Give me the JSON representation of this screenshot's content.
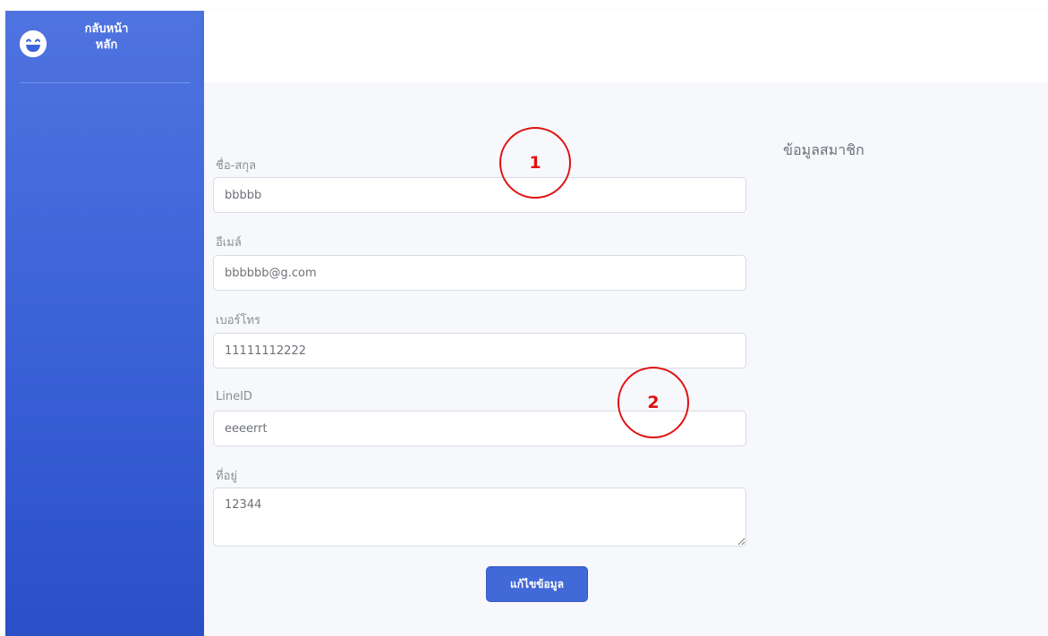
{
  "sidebar": {
    "brand_line1": "กลับหน้า",
    "brand_line2": "หลัก",
    "brand_icon": "laughing-face-icon"
  },
  "page": {
    "title": "ข้อมูลสมาชิก"
  },
  "form": {
    "name": {
      "label": "ชื่อ-สกุล",
      "value": "bbbbb"
    },
    "email": {
      "label": "อีเมล์",
      "value": "bbbbbb@g.com"
    },
    "phone": {
      "label": "เบอร์โทร",
      "value": "11111112222"
    },
    "lineid": {
      "label": "LineID",
      "value": "eeeerrt"
    },
    "address": {
      "label": "ที่อยู่",
      "value": "12344"
    },
    "submit_label": "แก้ไขข้อมูล"
  },
  "annotations": {
    "marker1": "1",
    "marker2": "2",
    "color": "#e01010"
  },
  "colors": {
    "sidebar_top": "#4f74e0",
    "sidebar_bottom": "#2a4fc7",
    "button": "#4269d8"
  }
}
